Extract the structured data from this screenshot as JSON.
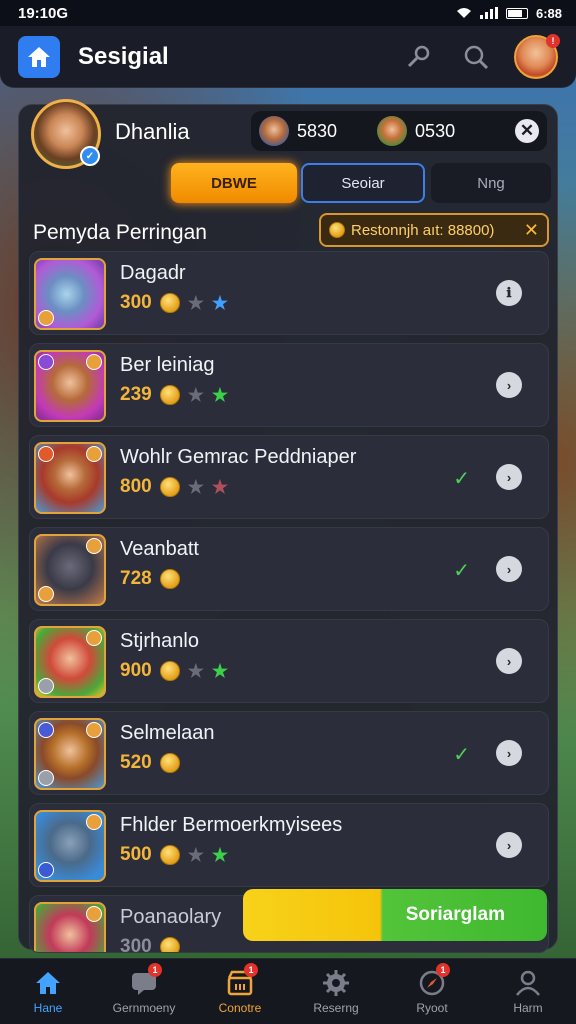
{
  "status_bar": {
    "time": "19:10G",
    "battery_text": "6:88"
  },
  "header": {
    "title": "Sesigial"
  },
  "profile": {
    "name": "Dhanlia",
    "currency": [
      {
        "value": "5830"
      },
      {
        "value": "0530"
      }
    ]
  },
  "tabs": [
    {
      "label": "DBWE"
    },
    {
      "label": "Seoiar"
    },
    {
      "label": "Nng"
    }
  ],
  "section_title": "Pemyda Perringan",
  "reward_pill": "Restonnjh aıt: 88800)",
  "items": [
    {
      "title": "Dagadr",
      "price": "300",
      "stars": [
        "grey",
        "blue"
      ],
      "checked": false,
      "button": "ℹ"
    },
    {
      "title": "Ber leiniag",
      "price": "239",
      "stars": [
        "grey",
        "green"
      ],
      "checked": false,
      "button": "›"
    },
    {
      "title": "Wohlr Gemrac Peddniaper",
      "price": "800",
      "stars": [
        "grey",
        "red"
      ],
      "checked": true,
      "button": "›"
    },
    {
      "title": "Veanbatt",
      "price": "728",
      "stars": [],
      "checked": true,
      "button": "›"
    },
    {
      "title": "Stjrhanlo",
      "price": "900",
      "stars": [
        "grey",
        "green"
      ],
      "checked": false,
      "button": "›"
    },
    {
      "title": "Selmelaan",
      "price": "520",
      "stars": [],
      "checked": true,
      "button": "›"
    },
    {
      "title": "Fhlder Bermoerkmyisees",
      "price": "500",
      "stars": [
        "grey",
        "green"
      ],
      "checked": false,
      "button": "›"
    },
    {
      "title": "Poanaolary",
      "price": "300"
    }
  ],
  "cta_label": "Soriarglam",
  "bottom_nav": [
    {
      "label": "Hane",
      "badge": ""
    },
    {
      "label": "Gernmoeny",
      "badge": "1"
    },
    {
      "label": "Conotre",
      "badge": "1"
    },
    {
      "label": "Reserng",
      "badge": ""
    },
    {
      "label": "Ryoot",
      "badge": "1"
    },
    {
      "label": "Harm",
      "badge": ""
    }
  ],
  "colors": {
    "accent_orange": "#f59a0c",
    "accent_blue": "#2f7df0",
    "check_green": "#4fd05a",
    "price_gold": "#f3b53a"
  }
}
